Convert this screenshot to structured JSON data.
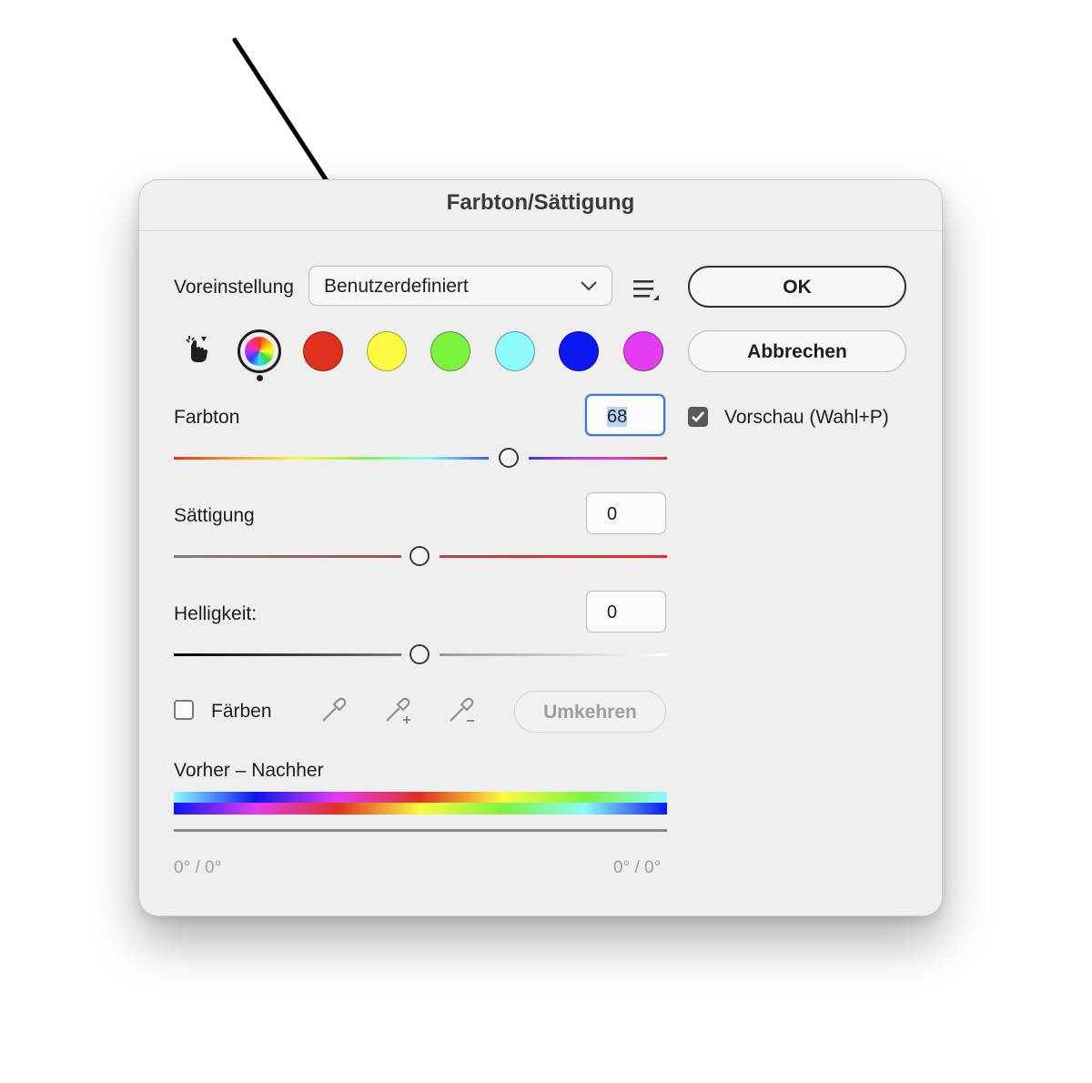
{
  "dialog": {
    "title": "Farbton/Sättigung",
    "preset_label": "Voreinstellung",
    "preset_value": "Benutzerdefiniert",
    "ok_label": "OK",
    "cancel_label": "Abbrechen",
    "preview_label": "Vorschau (Wahl+P)",
    "preview_checked": true,
    "hue_label": "Farbton",
    "hue_value": "68",
    "saturation_label": "Sättigung",
    "saturation_value": "0",
    "lightness_label": "Helligkeit:",
    "lightness_value": "0",
    "colorize_label": "Färben",
    "colorize_checked": false,
    "invert_label": "Umkehren",
    "before_after_label": "Vorher – Nachher",
    "range_left": "0° / 0°",
    "range_right": "0° / 0°",
    "swatches": [
      {
        "name": "master-swatch",
        "color": "rainbow"
      },
      {
        "name": "red-swatch",
        "color": "#e2301f"
      },
      {
        "name": "yellow-swatch",
        "color": "#fcfb3f"
      },
      {
        "name": "green-swatch",
        "color": "#7ef33f"
      },
      {
        "name": "cyan-swatch",
        "color": "#8cfbfc"
      },
      {
        "name": "blue-swatch",
        "color": "#0b16f0"
      },
      {
        "name": "magenta-swatch",
        "color": "#e33cf2"
      }
    ],
    "icons": [
      "hand-targeting-icon",
      "menu-icon",
      "chevron-down-icon",
      "eyedropper-icon",
      "eyedropper-plus-icon",
      "eyedropper-minus-icon",
      "checkmark-icon"
    ],
    "accent_color": "#3b78d8"
  }
}
